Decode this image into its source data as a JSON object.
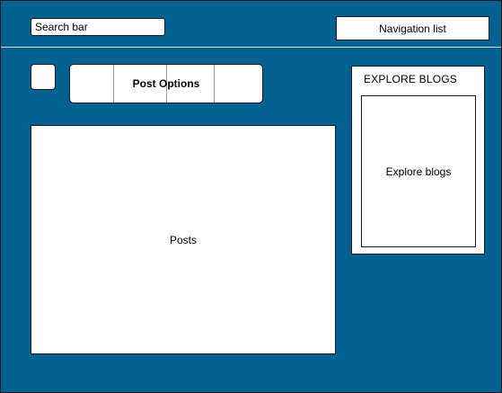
{
  "header": {
    "search": {
      "placeholder": "Search bar"
    },
    "navigation": {
      "label": "Navigation list"
    }
  },
  "toolbar": {
    "post_options_label": "Post Options"
  },
  "main": {
    "posts_label": "Posts"
  },
  "sidebar": {
    "heading": "EXPLORE BLOGS",
    "box_label": "Explore blogs"
  },
  "colors": {
    "background": "#036291",
    "panel": "#ffffff",
    "border": "#1a1a1a"
  }
}
